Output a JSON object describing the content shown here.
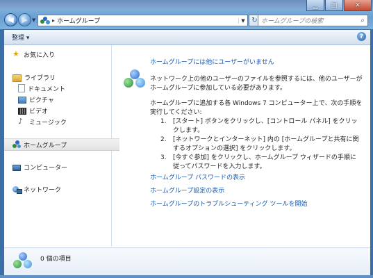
{
  "address": {
    "breadcrumb": [
      "ホームグループ"
    ],
    "search_placeholder": "ホームグループの検索"
  },
  "toolbar": {
    "organize_label": "整理 ▾",
    "help_label": "?"
  },
  "nav": {
    "favorites": "お気に入り",
    "libraries": "ライブラリ",
    "library_items": [
      "ドキュメント",
      "ピクチャ",
      "ビデオ",
      "ミュージック"
    ],
    "homegroup": "ホームグループ",
    "computer": "コンピューター",
    "network": "ネットワーク"
  },
  "content": {
    "heading": "ホームグループには他にユーザーがいません",
    "para1": "ネットワーク上の他のユーザーのファイルを参照するには、他のユーザーがホームグループに参加している必要があります。",
    "para2": "ホームグループに追加する各 Windows 7 コンピューター上で、次の手順を実行してください:",
    "steps": [
      {
        "num": "1.",
        "text": "[スタート] ボタンをクリックし、[コントロール パネル] をクリックします。"
      },
      {
        "num": "2.",
        "text": "[ネットワークとインターネット] 内の [ホームグループと共有に関するオプションの選択] をクリックします。"
      },
      {
        "num": "3.",
        "text": "[今すぐ参加] をクリックし、ホームグループ ウィザードの手順に従ってパスワードを入力します。"
      }
    ],
    "links": [
      "ホームグループ パスワードの表示",
      "ホームグループ設定の表示",
      "ホームグループのトラブルシューティング ツールを開始"
    ]
  },
  "status": {
    "item_count": "0 個の項目"
  },
  "colors": {
    "link": "#1a5ab0",
    "frame": "#7fb0dc"
  }
}
